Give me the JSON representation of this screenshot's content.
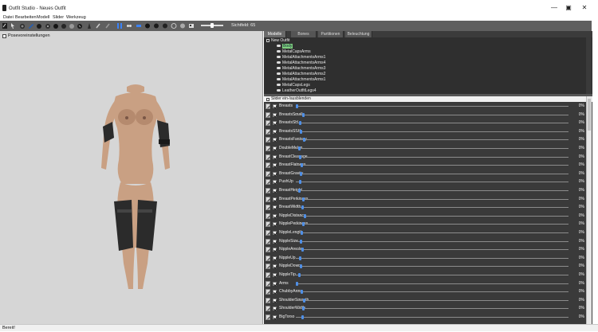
{
  "window": {
    "title": "Outfit Studio - Neues Outfit",
    "minimize": "—",
    "maximize": "▣",
    "close": "✕"
  },
  "menu": [
    "Datei",
    "Bearbeiten",
    "Modell",
    "Slider",
    "Werkzeug"
  ],
  "toolbar": {
    "icons": [
      "transform-icon",
      "select-icon",
      "brush-icon",
      "brush-icon",
      "brush-icon",
      "brush-icon",
      "brush-icon",
      "brush-icon",
      "brush-icon",
      "brush-icon",
      "brush-icon",
      "brush-icon",
      "brush-icon",
      "weight-icon",
      "color-icon",
      "mirror-icon",
      "view-icon",
      "view-icon",
      "sphere-icon",
      "sphere-icon",
      "sphere-icon",
      "light-icon",
      "camera-icon"
    ],
    "fov_label": "Sichtfeld: 65"
  },
  "viewport": {
    "checkbox_label": "Posevoreinstellungen"
  },
  "tabs": [
    {
      "label": "Modelle",
      "active": true
    },
    {
      "label": "Bones",
      "active": false
    },
    {
      "label": "Partitionen",
      "active": false
    },
    {
      "label": "Beleuchtung",
      "active": false
    }
  ],
  "tree": {
    "root": "New Outfit",
    "items": [
      {
        "label": "Body",
        "selected": true
      },
      {
        "label": "MetalCapsArms",
        "selected": false
      },
      {
        "label": "MetalAttachmentsArms1",
        "selected": false
      },
      {
        "label": "MetalAttachmentsArms4",
        "selected": false
      },
      {
        "label": "MetalAttachmentsArms3",
        "selected": false
      },
      {
        "label": "MetalAttachmentsArms2",
        "selected": false
      },
      {
        "label": "MetalAttachmentsArms1",
        "selected": false
      },
      {
        "label": "MetalCapsLegs",
        "selected": false
      },
      {
        "label": "LeatherOutfitLegs4",
        "selected": false
      }
    ]
  },
  "slider_panel": {
    "header": "Slider ein-/ausblenden",
    "sliders": [
      {
        "label": "Breasts",
        "percent_text": "0%",
        "value": 0
      },
      {
        "label": "BreastsSmall",
        "percent_text": "0%",
        "value": 0
      },
      {
        "label": "BreastsSH",
        "percent_text": "0%",
        "value": 0
      },
      {
        "label": "BreastsSSH",
        "percent_text": "0%",
        "value": 0
      },
      {
        "label": "BreastsFantasy",
        "percent_text": "0%",
        "value": 0
      },
      {
        "label": "DoubleMelon",
        "percent_text": "0%",
        "value": 0
      },
      {
        "label": "BreastCleavage",
        "percent_text": "0%",
        "value": 0
      },
      {
        "label": "BreastFlatness",
        "percent_text": "0%",
        "value": 0
      },
      {
        "label": "BreastGravity",
        "percent_text": "0%",
        "value": 0
      },
      {
        "label": "PushUp",
        "percent_text": "0%",
        "value": 0
      },
      {
        "label": "BreastHeight",
        "percent_text": "0%",
        "value": 0
      },
      {
        "label": "BreastPerkiness",
        "percent_text": "0%",
        "value": 0
      },
      {
        "label": "BreastWidth",
        "percent_text": "0%",
        "value": 0
      },
      {
        "label": "NippleDistance",
        "percent_text": "0%",
        "value": 0
      },
      {
        "label": "NipplePerkiness",
        "percent_text": "0%",
        "value": 0
      },
      {
        "label": "NippleLength",
        "percent_text": "0%",
        "value": 0
      },
      {
        "label": "NippleSize",
        "percent_text": "0%",
        "value": 0
      },
      {
        "label": "NippleAreola",
        "percent_text": "0%",
        "value": 0
      },
      {
        "label": "NippleUp",
        "percent_text": "0%",
        "value": 0
      },
      {
        "label": "NippleDown",
        "percent_text": "0%",
        "value": 0
      },
      {
        "label": "NippleTip",
        "percent_text": "0%",
        "value": 0
      },
      {
        "label": "Arms",
        "percent_text": "0%",
        "value": 0
      },
      {
        "label": "ChubbyArms",
        "percent_text": "0%",
        "value": 0
      },
      {
        "label": "ShoulderSmooth",
        "percent_text": "0%",
        "value": 0
      },
      {
        "label": "ShoulderWidth",
        "percent_text": "0%",
        "value": 0
      },
      {
        "label": "BigTorso",
        "percent_text": "0%",
        "value": 0
      }
    ]
  },
  "status": "Bereit!",
  "colors": {
    "slider_knob": "#4f8fe6",
    "selected_item": "#7fd07f",
    "skin": "#c9a083",
    "leather": "#2b2b2b"
  }
}
